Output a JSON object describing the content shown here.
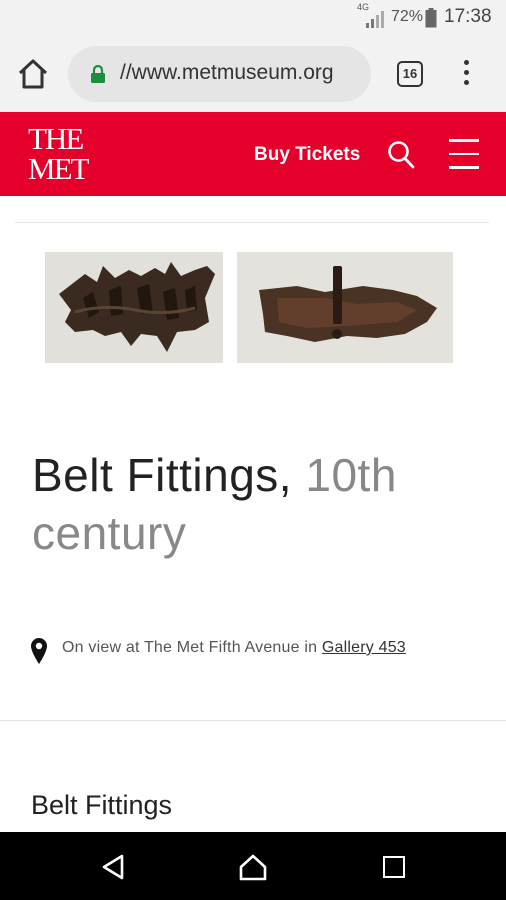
{
  "status_bar": {
    "network": "4G",
    "battery_percent": "72%",
    "battery_level": 0.72,
    "time": "17:38"
  },
  "browser": {
    "url": "//www.metmuseum.org",
    "tab_count": "16"
  },
  "site_header": {
    "logo_line_1": "THE",
    "logo_line_2": "MET",
    "buy_tickets": "Buy Tickets",
    "brand_color": "#e4002b"
  },
  "artwork": {
    "title": "Belt Fittings,",
    "date": "10th century",
    "location_prefix": "On view at The Met Fifth Avenue in",
    "gallery": "Gallery 453"
  },
  "section": {
    "heading": "Belt Fittings"
  },
  "icons": {
    "browser_home": "home-icon",
    "lock": "lock-icon",
    "tabs": "tabs-icon",
    "menu": "more-vert-icon",
    "search": "search-icon",
    "site_menu": "hamburger-icon",
    "location": "map-pin-icon",
    "nav_back": "back-icon",
    "nav_home": "home-icon",
    "nav_recents": "recents-icon"
  }
}
